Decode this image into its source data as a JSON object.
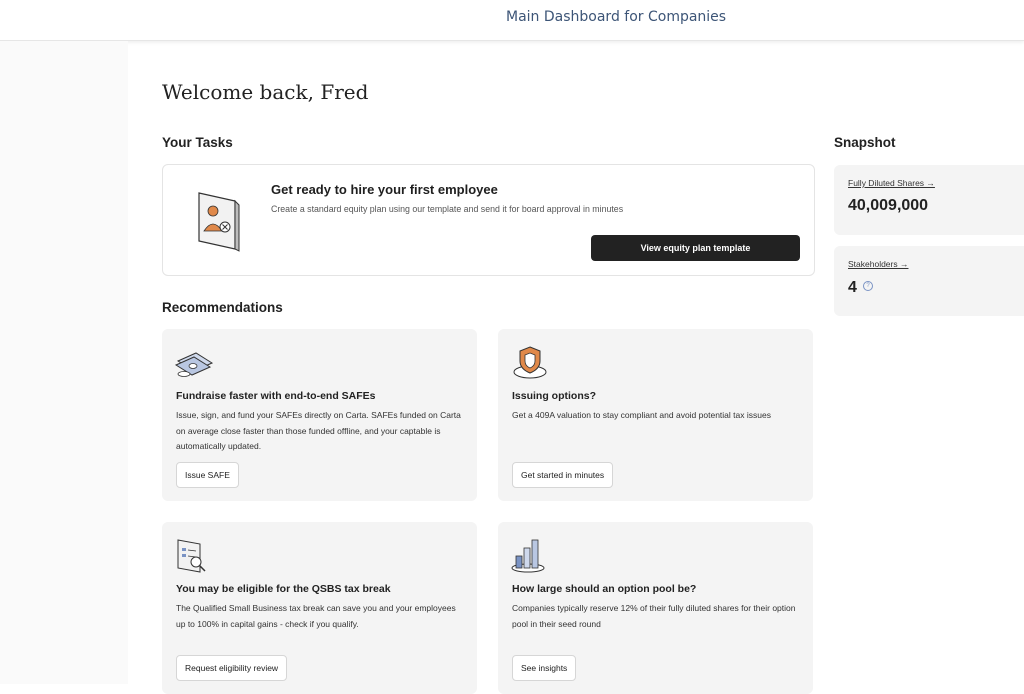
{
  "header": {
    "title": "Main Dashboard for Companies"
  },
  "welcome": "Welcome back, Fred",
  "tasks": {
    "section_title": "Your Tasks",
    "heading": "Get ready to hire your first employee",
    "description": "Create a standard equity plan using our template and send it for board approval in minutes",
    "button_label": "View equity plan template"
  },
  "snapshot": {
    "section_title": "Snapshot",
    "items": [
      {
        "label": "Fully Diluted Shares →",
        "value": "40,009,000"
      },
      {
        "label": "Stakeholders →",
        "value": "4"
      }
    ]
  },
  "recommendations": {
    "section_title": "Recommendations",
    "cards": [
      {
        "icon": "cash-icon",
        "title": "Fundraise faster with end-to-end SAFEs",
        "description": "Issue, sign, and fund your SAFEs directly on Carta. SAFEs funded on Carta on average close faster than those funded offline, and your captable is automatically updated.",
        "button": "Issue SAFE"
      },
      {
        "icon": "shield-icon",
        "title": "Issuing options?",
        "description": "Get a 409A valuation to stay compliant and avoid potential tax issues",
        "button": "Get started in minutes"
      },
      {
        "icon": "document-search-icon",
        "title": "You may be eligible for the QSBS tax break",
        "description": "The Qualified Small Business tax break can save you and your employees up to 100% in capital gains - check if you qualify.",
        "button": "Request eligibility review"
      },
      {
        "icon": "bar-chart-icon",
        "title": "How large should an option pool be?",
        "description": "Companies typically reserve 12% of their fully diluted shares for their option pool in their seed round",
        "button": "See insights"
      }
    ]
  },
  "colors": {
    "accent": "#222222",
    "card_bg": "#f4f4f4",
    "header_text": "#3d5577"
  }
}
